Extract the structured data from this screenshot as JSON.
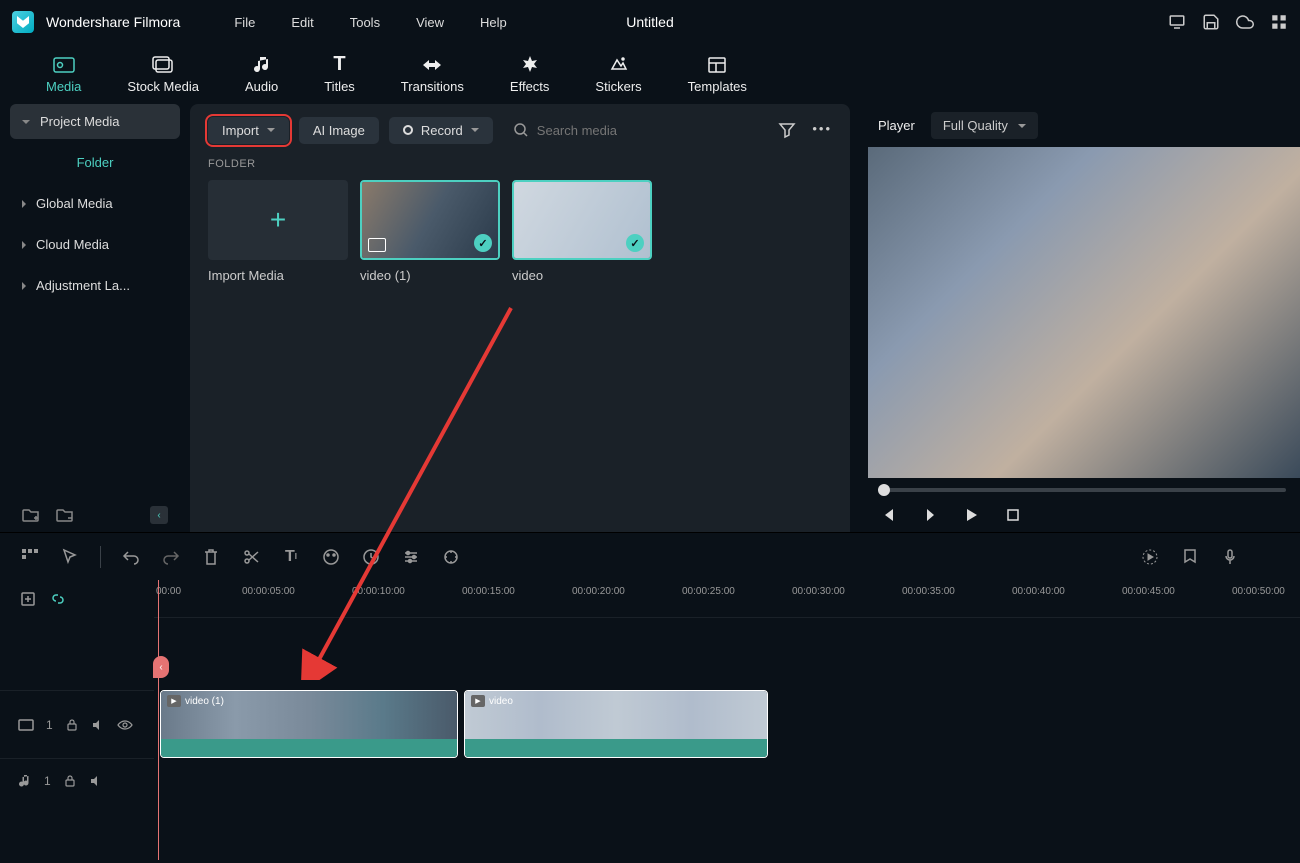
{
  "appTitle": "Wondershare Filmora",
  "docTitle": "Untitled",
  "menus": {
    "file": "File",
    "edit": "Edit",
    "tools": "Tools",
    "view": "View",
    "help": "Help"
  },
  "tabs": {
    "media": "Media",
    "stockMedia": "Stock Media",
    "audio": "Audio",
    "titles": "Titles",
    "transitions": "Transitions",
    "effects": "Effects",
    "stickers": "Stickers",
    "templates": "Templates"
  },
  "sidebar": {
    "projectMedia": "Project Media",
    "folder": "Folder",
    "globalMedia": "Global Media",
    "cloudMedia": "Cloud Media",
    "adjustmentLayer": "Adjustment La..."
  },
  "toolbar": {
    "import": "Import",
    "aiImage": "AI Image",
    "record": "Record",
    "searchPlaceholder": "Search media"
  },
  "folderLabel": "FOLDER",
  "mediaItems": {
    "importMedia": "Import Media",
    "video1": "video (1)",
    "video2": "video"
  },
  "preview": {
    "player": "Player",
    "quality": "Full Quality"
  },
  "timeline": {
    "clip1": "video (1)",
    "clip2": "video",
    "ticks": [
      "00:00",
      "00:00:05:00",
      "00:00:10:00",
      "00:00:15:00",
      "00:00:20:00",
      "00:00:25:00",
      "00:00:30:00",
      "00:00:35:00",
      "00:00:40:00",
      "00:00:45:00",
      "00:00:50:00"
    ],
    "videoTrack": "1",
    "audioTrack": "1"
  }
}
